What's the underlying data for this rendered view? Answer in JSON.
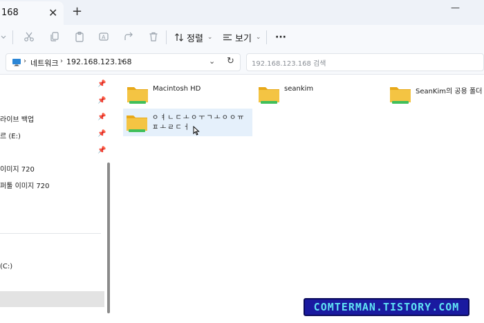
{
  "tab": {
    "title": "168",
    "close_glyph": "✕",
    "new_glyph": "+"
  },
  "window": {
    "minimize_glyph": "—"
  },
  "toolbar": {
    "sort_label": "정렬",
    "view_label": "보기",
    "more_glyph": "···"
  },
  "address": {
    "crumbs": [
      "네트워크",
      "192.168.123.168"
    ],
    "search_placeholder": "192.168.123.168 검색"
  },
  "sidebar": {
    "items": [
      {
        "label": "",
        "pinned": true
      },
      {
        "label": "",
        "pinned": true
      },
      {
        "label": "라이브 백업",
        "pinned": true
      },
      {
        "label": "르 (E:)",
        "pinned": true
      },
      {
        "label": "",
        "pinned": true
      },
      {
        "label": "이미지 720",
        "pinned": false
      },
      {
        "label": "퍼툴 이미지 720",
        "pinned": false
      },
      {
        "label": "(C:)",
        "pinned": false
      }
    ]
  },
  "folders": [
    {
      "name": "Macintosh HD",
      "selected": false
    },
    {
      "name": "seankim",
      "selected": false
    },
    {
      "name": "SeanKim의 공용 폴더",
      "selected": false
    },
    {
      "name": "ㅇㅕㄴㄷㅗㅇㅜㄱㅗㅇㅇㅠㅍㅗㄹㄷㅓ",
      "selected": true
    }
  ],
  "watermark": {
    "text": "COMTERMAN.TISTORY.COM"
  },
  "colors": {
    "folder_body": "#f4c443",
    "folder_tab": "#e8a91a",
    "folder_stripe": "#3fbf5a",
    "selection": "#e5f0fb",
    "watermark_bg": "#1a1aa0",
    "watermark_text": "#5fe3f5"
  }
}
